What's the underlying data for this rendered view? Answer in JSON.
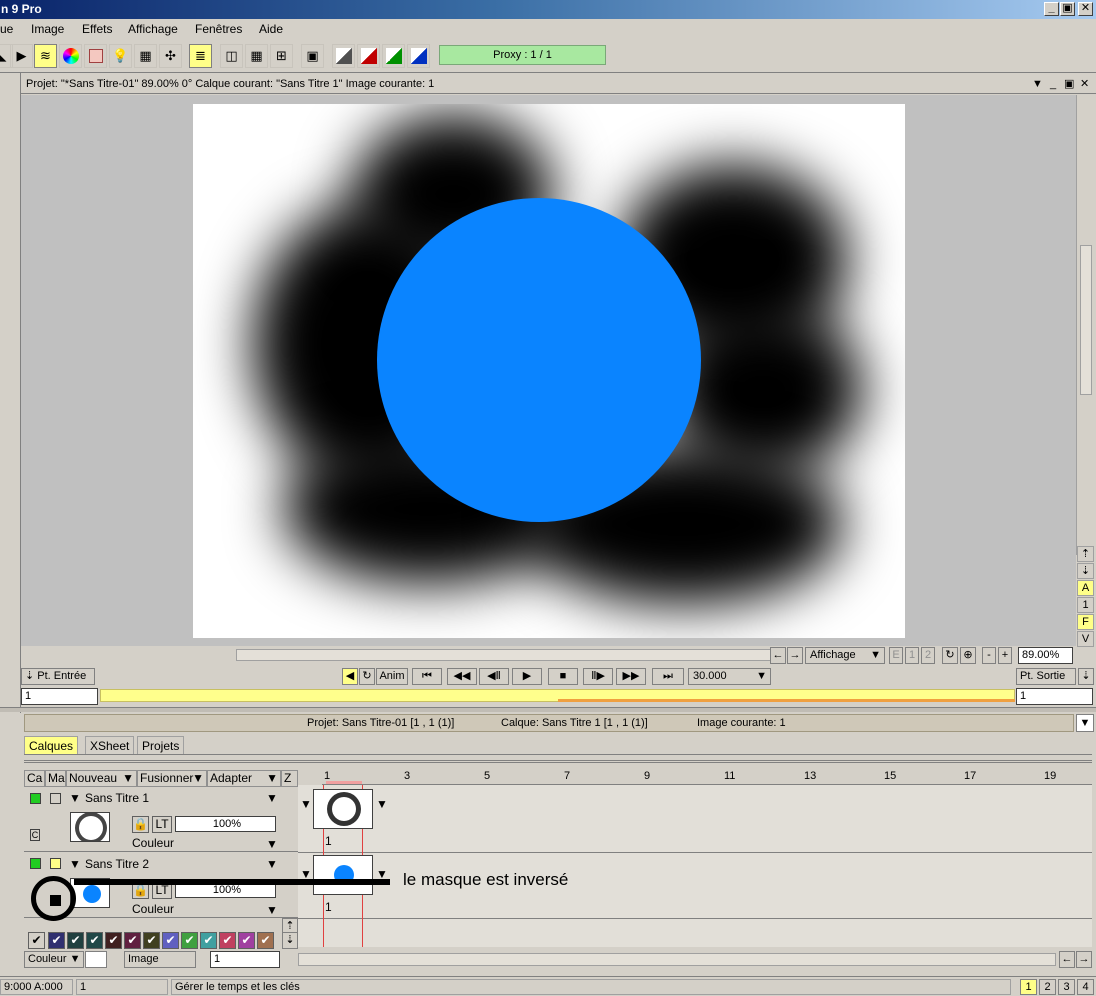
{
  "window": {
    "title": "n 9 Pro",
    "controls": [
      "_",
      "▣",
      "✕"
    ]
  },
  "menu": [
    "ue",
    "Image",
    "Effets",
    "Affichage",
    "Fenêtres",
    "Aide"
  ],
  "toolbar": {
    "proxy_label": "Proxy : 1 / 1"
  },
  "viewer": {
    "header_text": "Projet: \"*Sans Titre-01\"  89.00%   0°  Calque courant: \"Sans Titre 1\"  Image courante: 1",
    "side_labels": [
      "A",
      "1",
      "F",
      "V"
    ],
    "display_label": "Affichage",
    "zoom_value": "89.00%",
    "page_small": [
      "E",
      "1",
      "2"
    ]
  },
  "transport": {
    "in_label": "Pt. Entrée",
    "out_label": "Pt. Sortie",
    "anim_label": "Anim",
    "fps_value": "30.000",
    "in_value": "1",
    "out_value": "1"
  },
  "panel": {
    "project_info": "Projet: Sans Titre-01 [1 , 1  (1)]",
    "layer_info": "Calque: Sans Titre 1 [1 , 1  (1)]",
    "image_info": "Image courante: 1",
    "tabs": [
      "Calques",
      "XSheet",
      "Projets"
    ],
    "columns": {
      "ca": "Ca",
      "ma": "Ma",
      "nouveau": "Nouveau",
      "fusionner": "Fusionner",
      "adapter": "Adapter",
      "z": "Z"
    },
    "ruler": [
      "1",
      "3",
      "5",
      "7",
      "9",
      "11",
      "13",
      "15",
      "17",
      "19"
    ],
    "layers": [
      {
        "name": "Sans Titre 1",
        "opacity": "100%",
        "mode": "Couleur",
        "lt": "LT",
        "frame": "1",
        "badge": "C"
      },
      {
        "name": "Sans Titre 2",
        "opacity": "100%",
        "mode": "Couleur",
        "lt": "LT",
        "frame": "1"
      }
    ],
    "annotation": "le masque est inversé",
    "bottom": {
      "color_label": "Couleur",
      "image_label": "Image",
      "image_value": "1"
    }
  },
  "status": {
    "coords": "9:000 A:000",
    "frame": "1",
    "message": "Gérer le temps et les clés",
    "pages": [
      "1",
      "2",
      "3",
      "4"
    ]
  },
  "colors": {
    "circle": "#0a84ff",
    "highlight": "#ffff88",
    "proxy_bg": "#a8e8a0",
    "layer_on": "#22cc22",
    "swatches": [
      "#303070",
      "#204040",
      "#402020",
      "#602040",
      "#404020",
      "#6060c0",
      "#40a040",
      "#40a0a0",
      "#c04060",
      "#a040a0",
      "#a07050"
    ]
  }
}
